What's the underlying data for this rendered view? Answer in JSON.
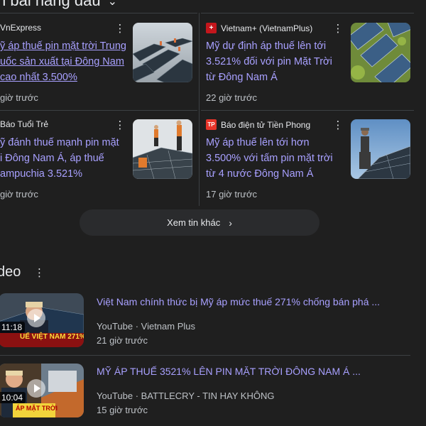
{
  "top_stories": {
    "title": "n bài hàng đầu",
    "cards": [
      {
        "source": "VnExpress",
        "headline_lines": [
          "ỹ áp thuế pin mặt trời Trung",
          "uốc sản xuất tại Đông Nam",
          "cao nhất 3.500%"
        ],
        "time": "giờ trước",
        "favicon_color": "#1c1c1c"
      },
      {
        "source": "Vietnam+ (VietnamPlus)",
        "headline_lines": [
          "Mỹ dự định áp thuế lên tới",
          "3.521% đối với pin Mặt Trời",
          "từ Đông Nam Á"
        ],
        "time": "22 giờ trước",
        "favicon_color": "#c4161c"
      },
      {
        "source": "Báo Tuổi Trẻ",
        "headline_lines": [
          "ỹ đánh thuế mạnh pin mặt",
          "i Đông Nam Á, áp thuế",
          "ampuchia 3.521%"
        ],
        "time": "giờ trước",
        "favicon_color": "#1c1c1c"
      },
      {
        "source": "Báo điện tử Tiền Phong",
        "headline_lines": [
          "Mỹ áp thuế lên tới hơn",
          "3.500% với tấm pin mặt trời",
          "từ 4 nước Đông Nam Á"
        ],
        "time": "17 giờ trước",
        "favicon_color": "#e8352a"
      }
    ],
    "more_label": "Xem tin khác"
  },
  "videos": {
    "title": "deo",
    "items": [
      {
        "title": "Việt Nam chính thức bị Mỹ áp mức thuế 271% chống bán phá ...",
        "source": "YouTube · Vietnam Plus",
        "time": "21 giờ trước",
        "duration": "11:18",
        "overlay": "UẾ VIỆT NAM 271%"
      },
      {
        "title": "MỸ ÁP THUẾ 3521% LÊN PIN MẶT TRỜI ĐÔNG NAM Á ...",
        "source": "YouTube · BATTLECRY - TIN HAY KHÔNG",
        "time": "15 giờ trước",
        "duration": "10:04",
        "overlay": "ÁP MẶT TRỜI"
      }
    ]
  },
  "favicon_labels": {
    "vietnamplus": "+",
    "tienphong": "TP"
  }
}
